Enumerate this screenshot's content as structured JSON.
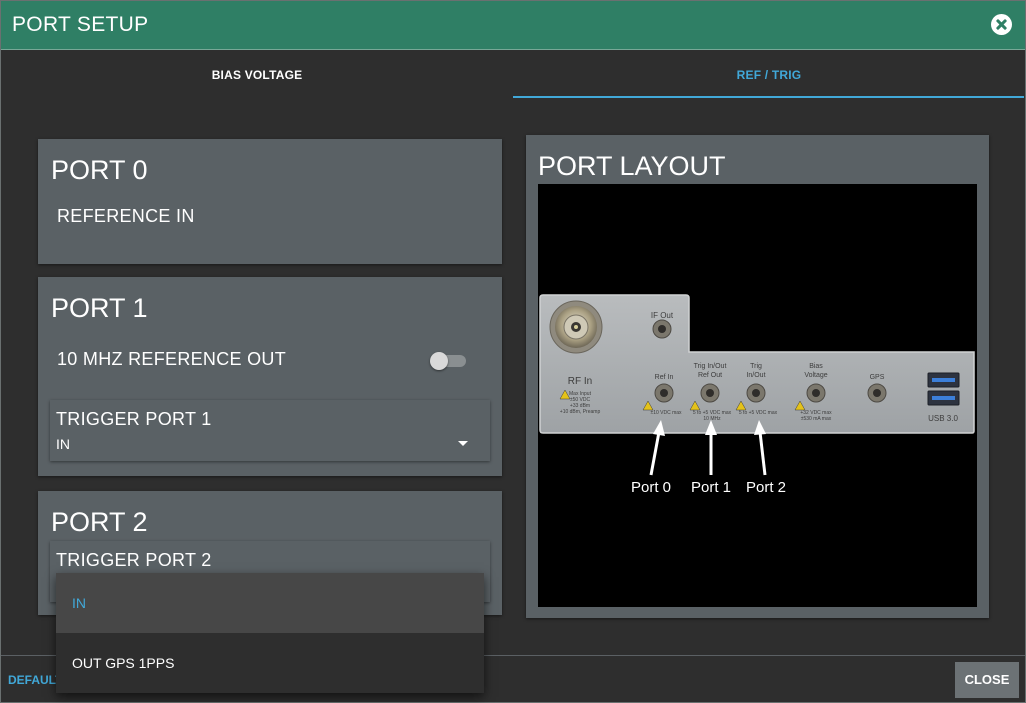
{
  "dialog": {
    "title": "PORT SETUP"
  },
  "tabs": [
    {
      "label": "BIAS VOLTAGE",
      "active": false
    },
    {
      "label": "REF / TRIG",
      "active": true
    }
  ],
  "port0": {
    "title": "PORT 0",
    "function_label": "REFERENCE IN"
  },
  "port1": {
    "title": "PORT 1",
    "ref_out_label": "10 MHZ REFERENCE OUT",
    "ref_out_enabled": false,
    "trigger": {
      "label": "TRIGGER PORT 1",
      "value": "IN"
    }
  },
  "port2": {
    "title": "PORT 2",
    "trigger": {
      "label": "TRIGGER PORT 2"
    }
  },
  "dropdown": {
    "options": [
      "IN",
      "OUT GPS 1PPS"
    ],
    "selected": "IN"
  },
  "layout": {
    "title": "PORT LAYOUT",
    "panel_labels": {
      "if_out": "IF Out",
      "rf_in": "RF In",
      "rf_in_warning": [
        "Max Input",
        "±50 VDC",
        "+33 dBm",
        "+10 dBm, Preamp"
      ],
      "ref_in": "Ref In",
      "ref_in_spec": "±10 VDC max",
      "trig_ref_out": [
        "Trig In/Out",
        "Ref Out"
      ],
      "trig_ref_out_spec": [
        "5 to +5 VDC max",
        "10 MHz"
      ],
      "trig_in_out": [
        "Trig",
        "In/Out"
      ],
      "trig_in_out_spec": "5 to +5 VDC max",
      "bias_voltage": [
        "Bias",
        "Voltage"
      ],
      "bias_spec": [
        "+32 VDC max",
        "±530 mA max"
      ],
      "gps": "GPS",
      "usb": "USB 3.0"
    },
    "port_callouts": [
      "Port 0",
      "Port 1",
      "Port 2"
    ]
  },
  "footer": {
    "default_label": "DEFAULT",
    "close_label": "CLOSE"
  },
  "colors": {
    "title_bar": "#2f7f65",
    "accent": "#41a8d8",
    "card": "#5a6165",
    "background": "#2e2e2e"
  }
}
